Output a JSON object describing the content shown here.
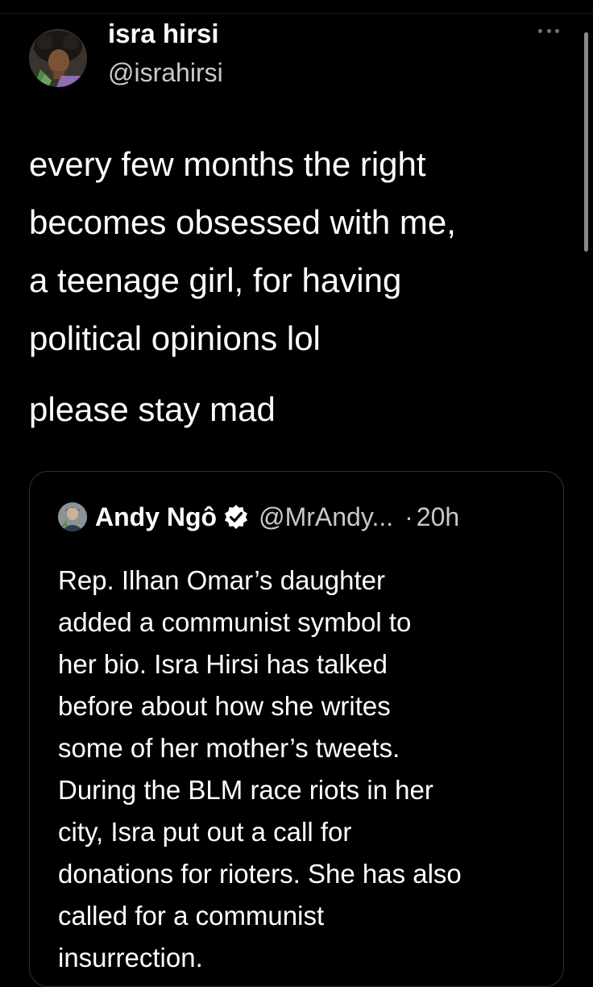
{
  "tweet": {
    "author_name": "isra hirsi",
    "author_handle": "@israhirsi",
    "text": "every few months the right\nbecomes obsessed with me,\na teenage girl, for having\npolitical opinions lol",
    "text_2": "please stay mad"
  },
  "quoted_tweet": {
    "author_name": "Andy Ngô",
    "author_handle": "@MrAndy...",
    "separator": "·",
    "time": "20h",
    "text": "Rep. Ilhan Omar’s daughter\nadded a communist symbol to\nher bio. Isra Hirsi has talked\nbefore about how she writes\nsome of her mother’s tweets.\nDuring the BLM race riots in her\ncity, Isra put out a call for\ndonations for rioters. She has also\ncalled for a communist\ninsurrection."
  },
  "icons": {
    "more": "more-horizontal-icon",
    "verified": "verified-badge-icon"
  },
  "colors": {
    "background": "#000000",
    "primary_text": "#ffffff",
    "secondary_text": "#c9c9c9",
    "border": "#2f3336"
  }
}
